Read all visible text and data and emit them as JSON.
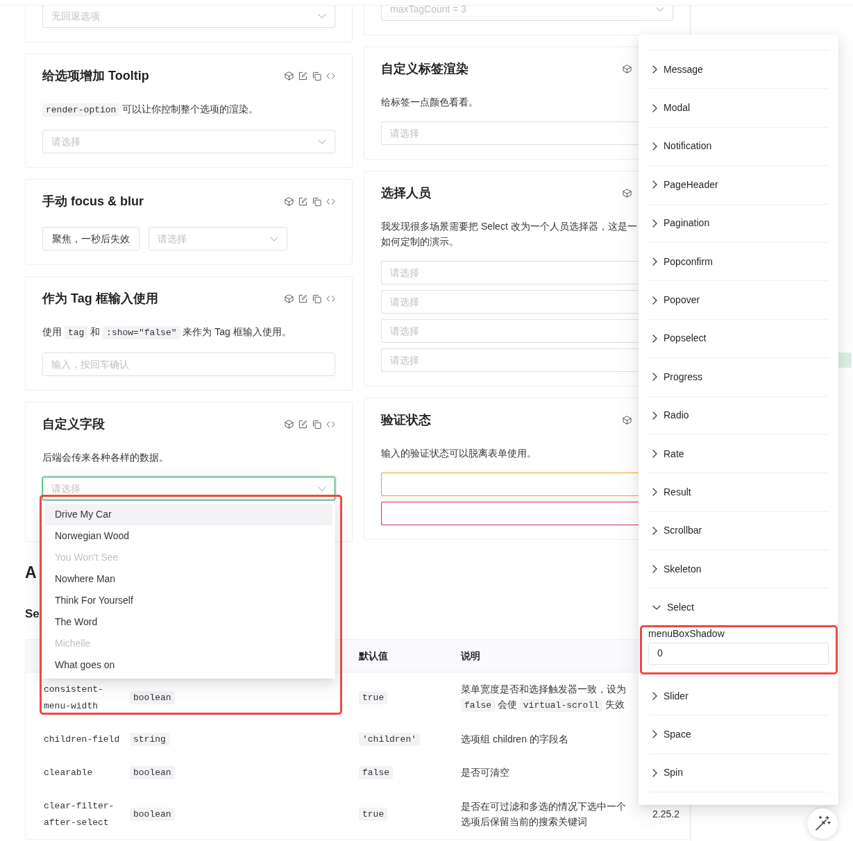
{
  "demo_columns": [
    {
      "cards": [
        {
          "control_rows": [
            [
              {
                "kind": "select",
                "placeholder": "无回退选项",
                "focused": false,
                "open": false
              }
            ]
          ]
        },
        {
          "title": "给选项增加 Tooltip",
          "description": [
            {
              "kind": "code",
              "text": "render-option"
            },
            {
              "kind": "text",
              "text": " 可以让你控制整个选项的渲染。"
            }
          ],
          "control_rows": [
            [
              {
                "kind": "select",
                "placeholder": "请选择",
                "focused": false,
                "open": false
              }
            ]
          ]
        },
        {
          "title": "手动 focus & blur",
          "control_rows": [
            [
              {
                "kind": "button",
                "label": "聚焦，一秒后失效"
              },
              {
                "kind": "select",
                "placeholder": "请选择",
                "focused": false,
                "open": false
              }
            ]
          ]
        },
        {
          "title": "作为 Tag 框输入使用",
          "description": [
            {
              "kind": "text",
              "text": "使用 "
            },
            {
              "kind": "code",
              "text": "tag"
            },
            {
              "kind": "text",
              "text": " 和 "
            },
            {
              "kind": "code",
              "text": ":show=\"false\""
            },
            {
              "kind": "text",
              "text": " 来作为 Tag 框输入使用。"
            }
          ],
          "control_rows": [
            [
              {
                "kind": "input",
                "placeholder": "输入，按回车确认",
                "focused": false
              }
            ]
          ]
        },
        {
          "title": "自定义字段",
          "description": [
            {
              "kind": "text",
              "text": "后端会传来各种各样的数据。"
            }
          ],
          "control_rows": [
            [
              {
                "kind": "select",
                "placeholder": "请选择",
                "focused": true,
                "open": true,
                "menu": {
                  "highlighted": true,
                  "options": [
                    {
                      "label": "Drive My Car",
                      "hovered": true,
                      "disabled": false,
                      "selected": false
                    },
                    {
                      "label": "Norwegian Wood",
                      "hovered": false,
                      "disabled": false,
                      "selected": false
                    },
                    {
                      "label": "You Won't See",
                      "hovered": false,
                      "disabled": true,
                      "selected": false
                    },
                    {
                      "label": "Nowhere Man",
                      "hovered": false,
                      "disabled": false,
                      "selected": false
                    },
                    {
                      "label": "Think For Yourself",
                      "hovered": false,
                      "disabled": false,
                      "selected": false
                    },
                    {
                      "label": "The Word",
                      "hovered": false,
                      "disabled": false,
                      "selected": false
                    },
                    {
                      "label": "Michelle",
                      "hovered": false,
                      "disabled": true,
                      "selected": false
                    },
                    {
                      "label": "What goes on",
                      "hovered": false,
                      "disabled": false,
                      "selected": false
                    }
                  ]
                }
              }
            ]
          ]
        }
      ]
    },
    {
      "cards": [
        {
          "control_rows": [
            [
              {
                "kind": "select",
                "placeholder": "maxTagCount = 3",
                "focused": false,
                "open": false
              }
            ]
          ]
        },
        {
          "title": "自定义标签渲染",
          "description": [
            {
              "kind": "text",
              "text": "给标签一点颜色看看。"
            }
          ],
          "control_rows": [
            [
              {
                "kind": "select",
                "placeholder": "请选择",
                "focused": false,
                "open": false
              }
            ]
          ]
        },
        {
          "title": "选择人员",
          "description": [
            {
              "kind": "text",
              "text": "我发现很多场景需要把 Select 改为一个人员选择器，这是一如何定制的演示。"
            }
          ],
          "control_rows": [
            [
              {
                "kind": "select",
                "placeholder": "请选择",
                "focused": false,
                "open": false
              }
            ],
            [
              {
                "kind": "select",
                "placeholder": "请选择",
                "focused": false,
                "open": false
              }
            ],
            [
              {
                "kind": "select",
                "placeholder": "请选择",
                "focused": false,
                "open": false
              }
            ],
            [
              {
                "kind": "select",
                "placeholder": "请选择",
                "focused": false,
                "open": false
              }
            ]
          ]
        },
        {
          "title": "验证状态",
          "description": [
            {
              "kind": "text",
              "text": "输入的验证状态可以脱离表单使用。"
            }
          ],
          "control_rows": [
            [
              {
                "kind": "select",
                "color": "#f0a020",
                "focused": false,
                "open": false
              }
            ],
            [
              {
                "kind": "select",
                "color": "#d03050",
                "focused": false,
                "open": false
              }
            ]
          ]
        }
      ]
    }
  ],
  "api_section": {
    "title": "A",
    "subtitle": "Se",
    "table": {
      "columns": {
        "default": "默认值",
        "description": "说明"
      },
      "rows": [
        {
          "name": "consistent-menu-width",
          "type": "boolean",
          "default": "true",
          "description": [
            {
              "kind": "text",
              "text": "菜单宽度是否和选择触发器一致，设为 "
            },
            {
              "kind": "code",
              "text": "false"
            },
            {
              "kind": "text",
              "text": " 会使 "
            },
            {
              "kind": "code",
              "text": "virtual-scroll"
            },
            {
              "kind": "text",
              "text": " 失效"
            }
          ]
        },
        {
          "name": "children-field",
          "type": "string",
          "default": "'children'",
          "description": [
            {
              "kind": "text",
              "text": "选项组 children 的字段名"
            }
          ]
        },
        {
          "name": "clearable",
          "type": "boolean",
          "default": "false",
          "description": [
            {
              "kind": "text",
              "text": "是否可清空"
            }
          ]
        },
        {
          "name": "clear-filter-after-select",
          "type": "boolean",
          "default": "true",
          "description": [
            {
              "kind": "text",
              "text": "是否在可过滤和多选的情况下选中一个选项后保留当前的搜索关键词"
            }
          ],
          "version": "2.25.2"
        }
      ]
    }
  },
  "theme_editor": {
    "items": [
      {
        "label": "Message",
        "expanded": false
      },
      {
        "label": "Modal",
        "expanded": false
      },
      {
        "label": "Notification",
        "expanded": false
      },
      {
        "label": "PageHeader",
        "expanded": false
      },
      {
        "label": "Pagination",
        "expanded": false
      },
      {
        "label": "Popconfirm",
        "expanded": false
      },
      {
        "label": "Popover",
        "expanded": false
      },
      {
        "label": "Popselect",
        "expanded": false
      },
      {
        "label": "Progress",
        "expanded": false
      },
      {
        "label": "Radio",
        "expanded": false
      },
      {
        "label": "Rate",
        "expanded": false
      },
      {
        "label": "Result",
        "expanded": false
      },
      {
        "label": "Scrollbar",
        "expanded": false
      },
      {
        "label": "Skeleton",
        "expanded": false
      },
      {
        "label": "Select",
        "expanded": true,
        "fields": [
          {
            "label": "menuBoxShadow",
            "value": "0",
            "highlighted": true
          }
        ]
      },
      {
        "label": "Slider",
        "expanded": false
      },
      {
        "label": "Space",
        "expanded": false
      },
      {
        "label": "Spin",
        "expanded": false
      }
    ]
  },
  "toc": {
    "items": [
      {
        "selected": true
      }
    ]
  }
}
